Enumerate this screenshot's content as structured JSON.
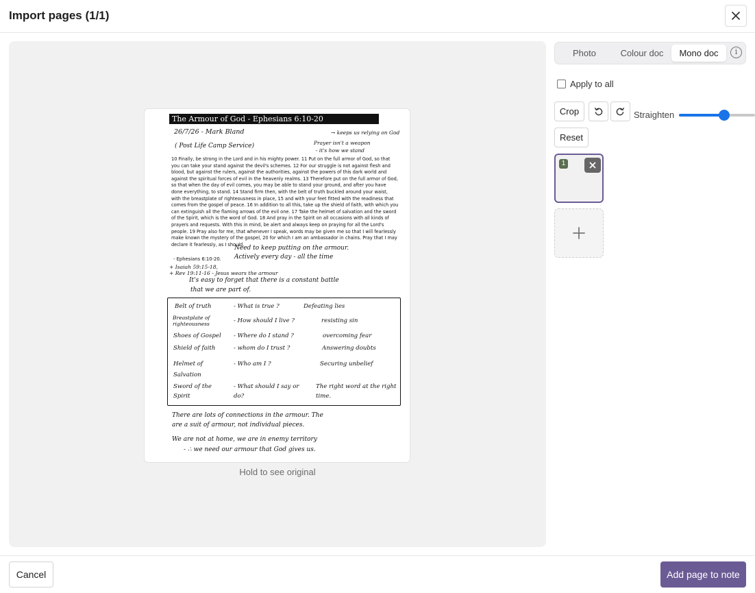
{
  "dialog": {
    "title": "Import pages (1/1)"
  },
  "preview": {
    "hint": "Hold to see original",
    "document": {
      "title": "The Armour of God - Ephesians 6:10-20",
      "date_line": "26/7/26 - Mark Bland",
      "service_line": "( Post Life Camp Service)",
      "note_right_1": "→ keeps us relying on God",
      "note_right_2": "Prayer isn't a weapon",
      "note_right_3": "- it's how we stand",
      "passage": "10 Finally, be strong in the Lord and in his mighty power. 11 Put on the full armor of God, so that you can take your stand against the devil's schemes. 12 For our struggle is not against flesh and blood, but against the rulers, against the authorities, against the powers of this dark world and against the spiritual forces of evil in the heavenly realms. 13 Therefore put on the full armor of God, so that when the day of evil comes, you may be able to stand your ground, and after you have done everything, to stand. 14 Stand firm then, with the belt of truth buckled around your waist, with the breastplate of righteousness in place, 15 and with your feet fitted with the readiness that comes from the gospel of peace. 16 In addition to all this, take up the shield of faith, with which you can extinguish all the flaming arrows of the evil one. 17 Take the helmet of salvation and the sword of the Spirit, which is the word of God. 18 And pray in the Spirit on all occasions with all kinds of prayers and requests. With this in mind, be alert and always keep on praying for all the Lord's people. 19 Pray also for me, that whenever I speak, words may be given me so that I will fearlessly make known the mystery of the gospel, 20 for which I am an ambassador in chains. Pray that I may declare it fearlessly, as I should.",
      "reference": "- Ephesians 6:10-20.",
      "note_1": "Need to keep putting on the armour.",
      "note_2": "Actively every day - all the time",
      "cross_ref_1": "+ Isaiah 59:15-18,",
      "cross_ref_2": "+ Rev 19:11-16 - Jesus wears the armour",
      "note_3": "It's easy to forget that there is a constant battle",
      "note_4": "that we are part of.",
      "table_rows": [
        {
          "piece": "Belt of truth",
          "question": "- What is true ?",
          "answer": "Defeating lies"
        },
        {
          "piece": "Breastplate of righteousness",
          "question": "- How should I live ?",
          "answer": "resisting sin"
        },
        {
          "piece": "Shoes of Gospel",
          "question": "- Where do I stand ?",
          "answer": "overcoming fear"
        },
        {
          "piece": "Shield of faith",
          "question": "- whom do I trust ?",
          "answer": "Answering doubts"
        },
        {
          "piece": "Helmet of Salvation",
          "question": "- Who am I ?",
          "answer": "Securing unbelief"
        },
        {
          "piece": "Sword of the Spirit",
          "question": "- What should I say or do?",
          "answer": "The right word at the right time."
        }
      ],
      "closing_1": "There are lots of connections in the armour. The",
      "closing_2": "are a suit of armour, not individual pieces.",
      "closing_3": "We are not at home, we are in enemy territory",
      "closing_4": "- ∴ we need our armour that God gives us."
    }
  },
  "sidebar": {
    "modes": [
      "Photo",
      "Colour doc",
      "Mono doc"
    ],
    "active_mode": "Mono doc",
    "apply_all_label": "Apply to all",
    "crop_label": "Crop",
    "straighten_label": "Straighten",
    "straighten_value": 0.5,
    "reset_label": "Reset",
    "thumbnail_number": "1"
  },
  "footer": {
    "cancel_label": "Cancel",
    "add_label": "Add page to note"
  },
  "colors": {
    "accent": "#6b5b95",
    "slider": "#1a73e8"
  }
}
